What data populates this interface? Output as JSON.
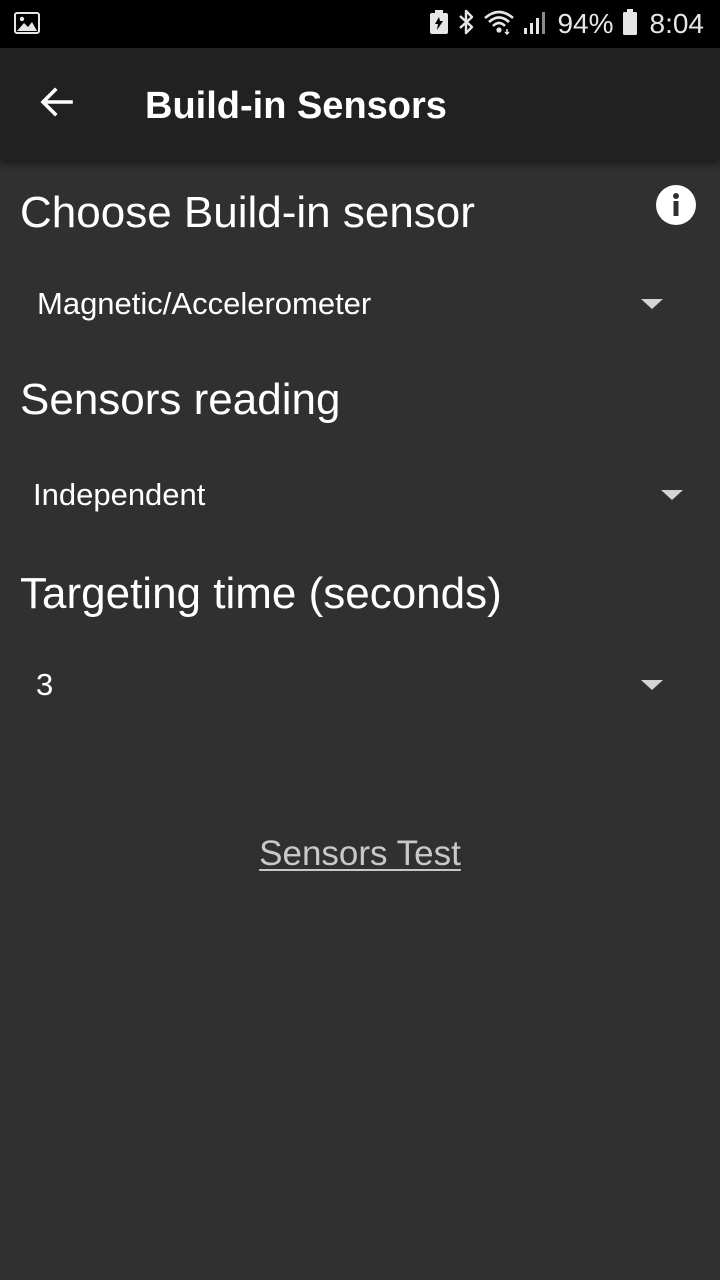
{
  "status_bar": {
    "battery_percent": "94%",
    "time": "8:04",
    "icons": [
      "gallery-icon",
      "battery-saver-icon",
      "bluetooth-icon",
      "wifi-icon",
      "signal-icon",
      "battery-icon"
    ]
  },
  "app_bar": {
    "title": "Build-in Sensors",
    "back_icon": "arrow-back-icon"
  },
  "sections": {
    "sensor": {
      "title": "Choose Build-in sensor",
      "selected": "Magnetic/Accelerometer",
      "info_icon": "info-icon"
    },
    "reading": {
      "title": "Sensors reading",
      "selected": "Independent"
    },
    "targeting": {
      "title": "Targeting time (seconds)",
      "selected": "3"
    }
  },
  "actions": {
    "sensors_test": "Sensors Test"
  },
  "colors": {
    "background": "#303030",
    "app_bar": "#212121",
    "status_bar": "#000000",
    "text": "#ffffff",
    "link": "#c8c8c8"
  }
}
